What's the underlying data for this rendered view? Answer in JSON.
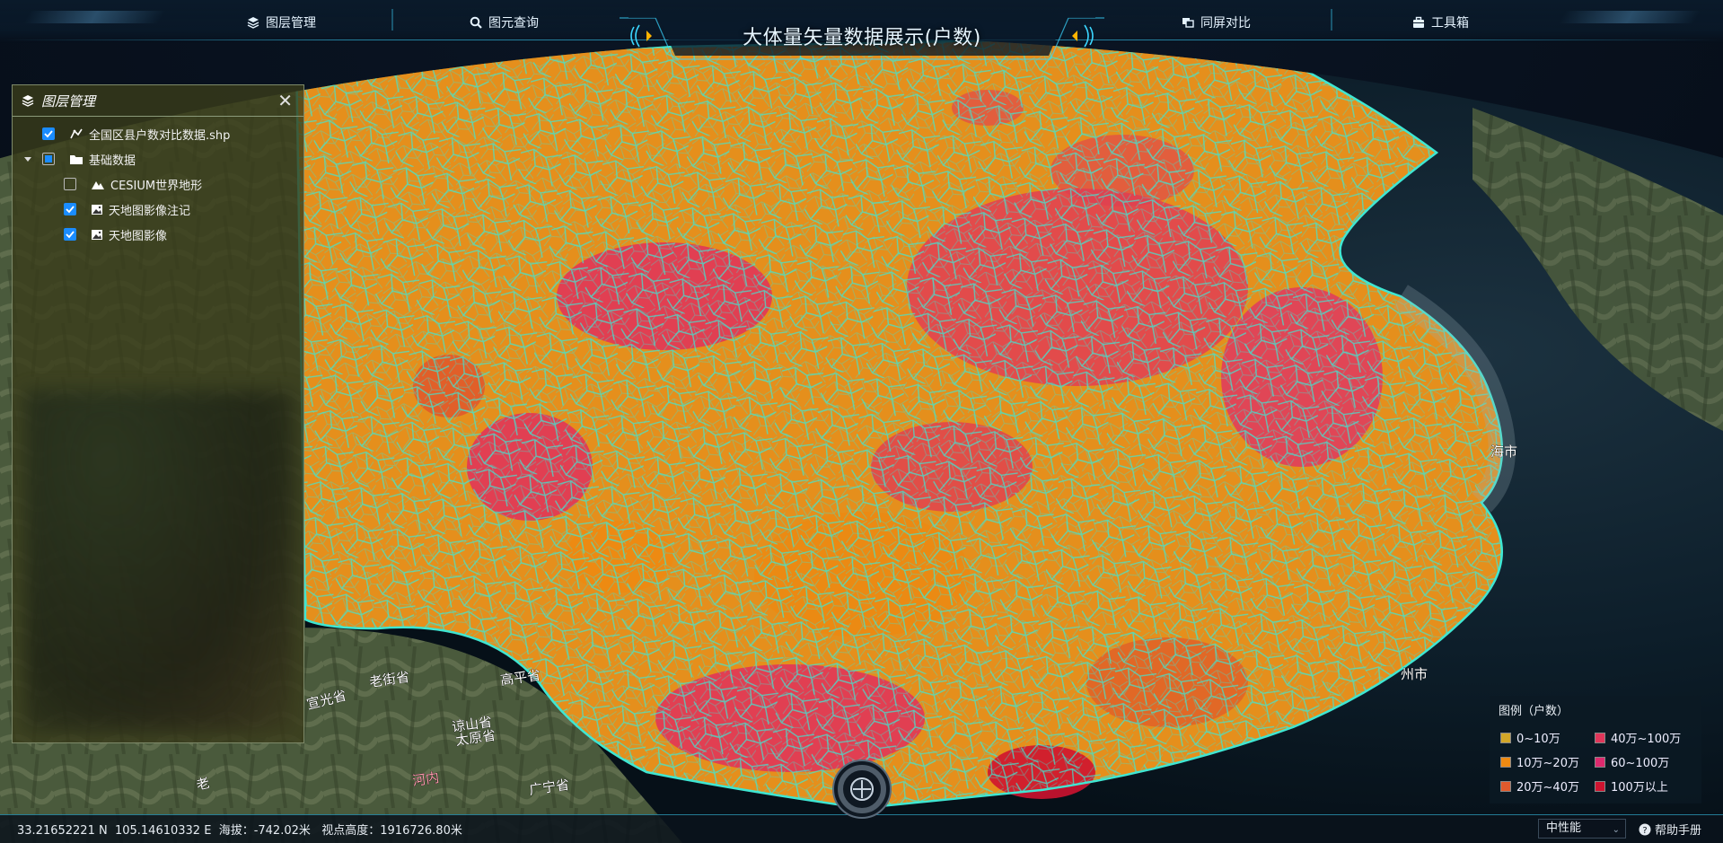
{
  "title": "大体量矢量数据展示(户数)",
  "nav": [
    {
      "label": "图层管理",
      "icon": "layers-icon"
    },
    {
      "label": "图元查询",
      "icon": "search-icon"
    },
    {
      "label": "同屏对比",
      "icon": "compare-icon"
    },
    {
      "label": "工具箱",
      "icon": "toolbox-icon"
    }
  ],
  "layer_panel": {
    "title": "图层管理",
    "items": [
      {
        "label": "全国区县户数对比数据.shp",
        "checked": "checked",
        "icon": "vector-icon"
      },
      {
        "label": "基础数据",
        "checked": "partial",
        "icon": "folder-icon"
      },
      {
        "label": "CESIUM世界地形",
        "checked": "unchecked",
        "icon": "terrain-icon"
      },
      {
        "label": "天地图影像注记",
        "checked": "checked",
        "icon": "image-icon"
      },
      {
        "label": "天地图影像",
        "checked": "checked",
        "icon": "image-icon"
      }
    ]
  },
  "map_labels": [
    {
      "text": "老街省"
    },
    {
      "text": "高平省"
    },
    {
      "text": "谅山省"
    },
    {
      "text": "太原省"
    },
    {
      "text": "河内"
    },
    {
      "text": "广宁省"
    },
    {
      "text": "宣光省"
    },
    {
      "text": "老"
    },
    {
      "text": "海市"
    },
    {
      "text": "州市"
    }
  ],
  "legend": {
    "title": "图例（户数）",
    "items": [
      {
        "label": "0~10万",
        "color": "#d2a628"
      },
      {
        "label": "40万~100万",
        "color": "#e0365a"
      },
      {
        "label": "10万~20万",
        "color": "#ee8a12"
      },
      {
        "label": "60~100万",
        "color": "#dd2a6e"
      },
      {
        "label": "20万~40万",
        "color": "#e05a2c"
      },
      {
        "label": "100万以上",
        "color": "#cf1430"
      }
    ]
  },
  "status": {
    "coords": "33.21652221 N  105.14610332 E  海拔：-742.02米   视点高度：1916726.80米",
    "performance": "中性能",
    "help": "帮助手册"
  }
}
